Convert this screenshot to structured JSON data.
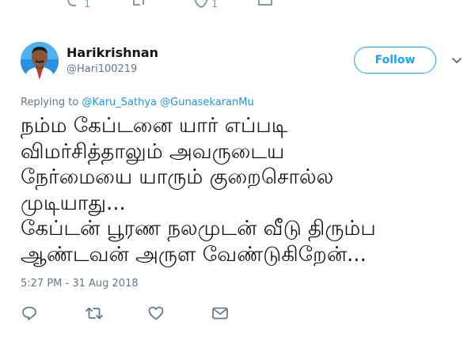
{
  "tweet": {
    "author": {
      "display_name": "Harikrishnan",
      "handle": "@Hari100219",
      "avatar_icon": "user-avatar-photo"
    },
    "follow_label": "Follow",
    "replying": {
      "prefix": "Replying to ",
      "mentions": [
        "@Karu_Sathya",
        "@GunasekaranMu"
      ]
    },
    "text_lines": [
      "நம்ம கேப்டனை யார் எப்படி",
      "விமர்சித்தாலும் அவருடைய",
      "நேர்மையை யாரும் குறைசொல்ல",
      "முடியாது...",
      "கேப்டன் பூரண நலமுடன் வீடு திரும்ப",
      "ஆண்டவன் அருள வேண்டுகிறேன்..."
    ],
    "timestamp": "5:27 PM - 31 Aug 2018",
    "previous_tweet_actions": {
      "reply_count": "1",
      "like_count": "1"
    }
  },
  "colors": {
    "accent": "#1da1f2",
    "mention": "#1b95e0",
    "muted": "#657786",
    "text": "#14171a"
  }
}
